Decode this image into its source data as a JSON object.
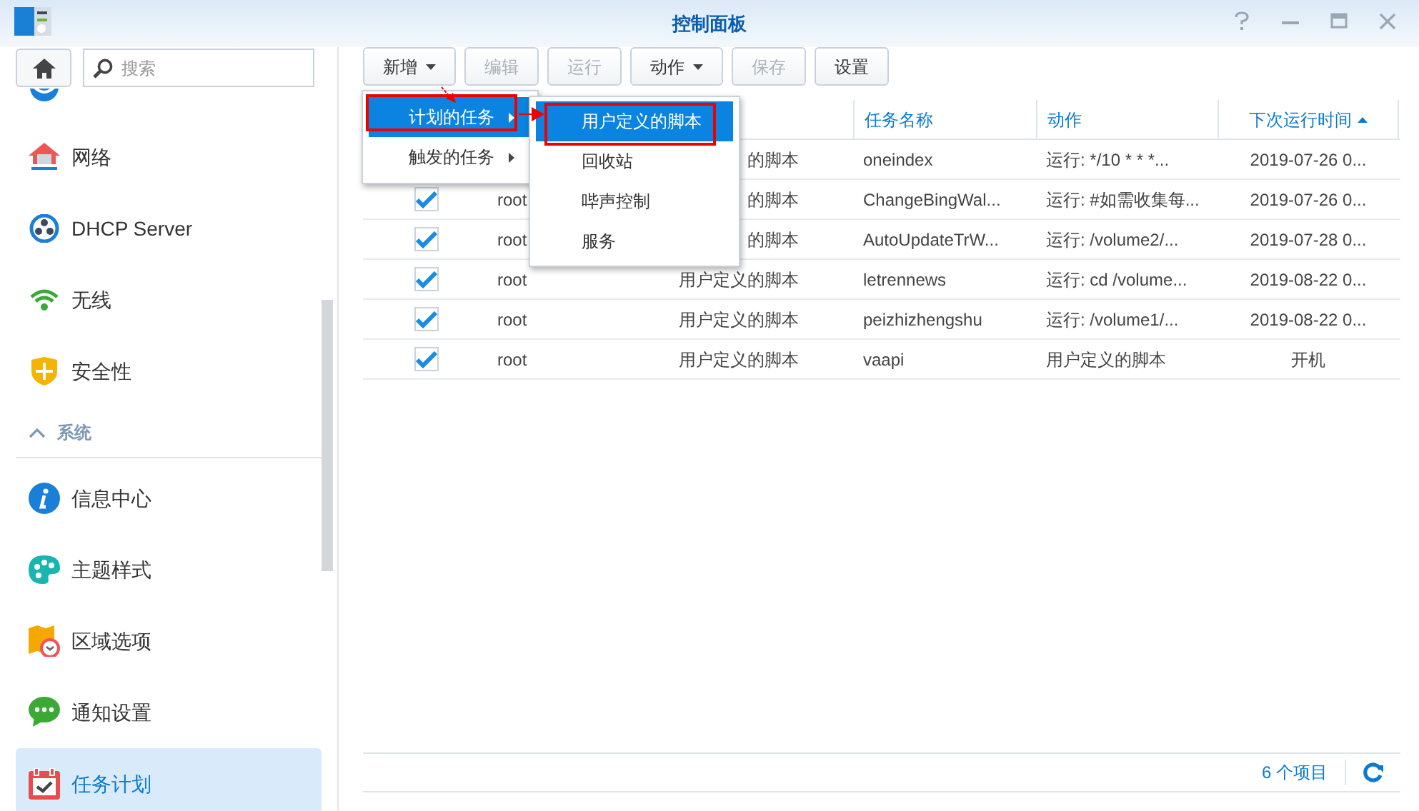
{
  "window": {
    "title": "控制面板"
  },
  "search": {
    "placeholder": "搜索"
  },
  "sidebar": {
    "items": [
      {
        "label": "网络",
        "selected": false
      },
      {
        "label": "DHCP Server",
        "selected": false
      },
      {
        "label": "无线",
        "selected": false
      },
      {
        "label": "安全性",
        "selected": false
      },
      {
        "kind": "section",
        "label": "系统",
        "expanded": true
      },
      {
        "label": "信息中心",
        "selected": false
      },
      {
        "label": "主题样式",
        "selected": false
      },
      {
        "label": "区域选项",
        "selected": false
      },
      {
        "label": "通知设置",
        "selected": false
      },
      {
        "label": "任务计划",
        "selected": true
      }
    ]
  },
  "toolbar": [
    {
      "label": "新增",
      "dropdown": true,
      "disabled": false
    },
    {
      "label": "编辑",
      "dropdown": false,
      "disabled": true
    },
    {
      "label": "运行",
      "dropdown": false,
      "disabled": true
    },
    {
      "label": "动作",
      "dropdown": true,
      "disabled": false
    },
    {
      "label": "保存",
      "dropdown": false,
      "disabled": true
    },
    {
      "label": "设置",
      "dropdown": false,
      "disabled": false
    }
  ],
  "table": {
    "columns": [
      "任务名称",
      "动作",
      "下次运行时间"
    ],
    "rows": [
      {
        "type": "的脚本",
        "name": "oneindex",
        "action": "运行: */10 * * *...",
        "next_run": "2019-07-26 0..."
      },
      {
        "checked": true,
        "user": "root",
        "type": "的脚本",
        "name": "ChangeBingWal...",
        "action": "运行: #如需收集每...",
        "next_run": "2019-07-26 0..."
      },
      {
        "checked": true,
        "user": "root",
        "type": "的脚本",
        "name": "AutoUpdateTrW...",
        "action": "运行: /volume2/...",
        "next_run": "2019-07-28 0..."
      },
      {
        "checked": true,
        "user": "root",
        "type": "用户定义的脚本",
        "name": "letrennews",
        "action": "运行: cd /volume...",
        "next_run": "2019-08-22 0..."
      },
      {
        "checked": true,
        "user": "root",
        "type": "用户定义的脚本",
        "name": "peizhizhengshu",
        "action": "运行: /volume1/...",
        "next_run": "2019-08-22 0..."
      },
      {
        "checked": true,
        "user": "root",
        "type": "用户定义的脚本",
        "name": "vaapi",
        "action": "用户定义的脚本",
        "next_run": "开机"
      }
    ]
  },
  "menu": {
    "items": [
      {
        "label": "计划的任务",
        "selected": true
      },
      {
        "label": "触发的任务",
        "selected": false
      }
    ]
  },
  "submenu": {
    "items": [
      {
        "label": "用户定义的脚本",
        "selected": true
      },
      {
        "label": "回收站",
        "selected": false
      },
      {
        "label": "哔声控制",
        "selected": false
      },
      {
        "label": "服务",
        "selected": false
      }
    ]
  },
  "status_bar": {
    "count": "6 个项目"
  }
}
